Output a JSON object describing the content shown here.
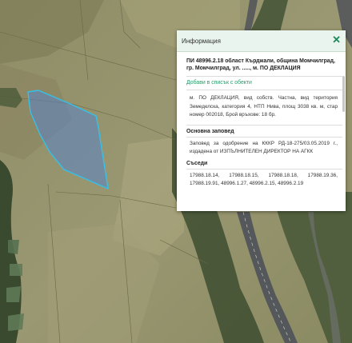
{
  "info_panel": {
    "title": "Информация",
    "close_icon": "close-icon",
    "parcel_heading": "ПИ 48996.2.18 област Кърджали, община Момчилград, гр. Момчилград, ул. ....., м. ПО ДЕКЛАЦИЯ",
    "add_to_list_link": "Добави в списък с обекти",
    "parcel_description": "м. ПО ДЕКЛАЦИЯ, вид собств. Частна, вид територия Земеделска, категория 4, НТП Нива, площ 3038 кв. м, стар номер 002018, Брой връхове: 18 бр.",
    "order_heading": "Основна заповед",
    "order_text": "Заповед за одобрение на КККР РД-18-275/03.05.2019 г., издадена от ИЗПЪЛНИТЕЛЕН ДИРЕКТОР НА АГКК",
    "neighbors_heading": "Съседи",
    "neighbors_text": "17988.18.14, 17988.18.15, 17988.18.18, 17988.19.36, 17988.19.91, 48996.1.27, 48996.2.15, 48996.2.19"
  },
  "colors": {
    "parcel_fill": "#5a84c8",
    "parcel_outline": "#36c0e8",
    "panel_header": "#e9f4ee",
    "link": "#2a9c6a"
  }
}
